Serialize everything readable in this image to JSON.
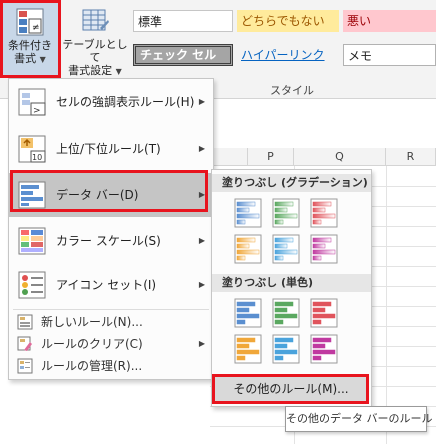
{
  "ribbon": {
    "conditional_formatting": {
      "line1": "条件付き",
      "line2": "書式"
    },
    "format_as_table": {
      "line1": "テーブルとして",
      "line2": "書式設定"
    },
    "group_label": "スタイル",
    "styles": {
      "normal": "標準",
      "neutral": "どちらでもない",
      "bad": "悪い",
      "check_cell": "チェック セル",
      "hyperlink": "ハイパーリンク",
      "memo": "メモ"
    }
  },
  "sheet": {
    "columns": [
      "P",
      "Q",
      "R"
    ]
  },
  "menu": {
    "items": [
      {
        "label": "セルの強調表示ルール(H)",
        "icon": "highlight-cells-icon"
      },
      {
        "label": "上位/下位ルール(T)",
        "icon": "top-bottom-icon"
      },
      {
        "label": "データ バー(D)",
        "icon": "data-bars-icon"
      },
      {
        "label": "カラー スケール(S)",
        "icon": "color-scales-icon"
      },
      {
        "label": "アイコン セット(I)",
        "icon": "icon-sets-icon"
      }
    ],
    "small_items": [
      {
        "label": "新しいルール(N)...",
        "icon": "new-rule-icon"
      },
      {
        "label": "ルールのクリア(C)",
        "icon": "clear-rules-icon"
      },
      {
        "label": "ルールの管理(R)...",
        "icon": "manage-rules-icon"
      }
    ]
  },
  "submenu": {
    "gradient_header": "塗りつぶし (グラデーション)",
    "solid_header": "塗りつぶし (単色)",
    "more_rules": "その他のルール(M)...",
    "bar_colors": [
      "#5b8fd0",
      "#5aa860",
      "#e0545c",
      "#f0a73a",
      "#4aa3dc",
      "#c03aa0"
    ]
  },
  "tooltip": "その他のデータ バーのルール",
  "colors": {
    "highlight_red": "#e8141e",
    "neutral_bg": "#ffeb9c",
    "neutral_fg": "#9c5700",
    "bad_bg": "#ffc7ce",
    "bad_fg": "#9c0006",
    "check_bg": "#a5a5a5"
  }
}
